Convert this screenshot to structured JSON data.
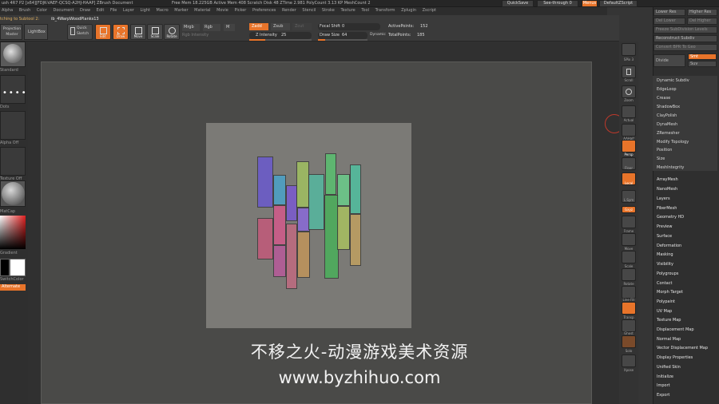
{
  "window": {
    "title_left": "ush 4R7 P2 [x64][FDJK-VAEF-QCSQ-A2HJ-HAAP]   ZBrush Document",
    "status": "Free Mem 18.225GB   Active Mem 408   Scratch Disk 48   ZTime 2.981   PolyCount 3.13 KP   MeshCount 2",
    "quicksave": "QuickSave",
    "seethrough": "See-through   0",
    "menus_btn": "Menus",
    "default_script": "DefaultZScript"
  },
  "menubar": [
    "Alpha",
    "Brush",
    "Color",
    "Document",
    "Draw",
    "Edit",
    "File",
    "Layer",
    "Light",
    "Macro",
    "Marker",
    "Material",
    "Movie",
    "Picker",
    "Preferences",
    "Render",
    "Stencil",
    "Stroke",
    "Texture",
    "Tool",
    "Transform",
    "Zplugin",
    "Zscript"
  ],
  "toolbar": {
    "switch_label": "tching to Subtool 2:",
    "subtool_name": "ib_4WarpWoodPlanks13",
    "projection_master": "Projection Master",
    "lightbox": "LightBox",
    "quick_sketch": "Quick Sketch",
    "tools": [
      "Edit",
      "Draw",
      "Move",
      "Scale",
      "Rotate"
    ],
    "mrgb": "Mrgb",
    "rgb": "Rgb",
    "m": "M",
    "rgb_intensity": "Rgb Intensity",
    "zadd": "Zadd",
    "zsub": "Zsub",
    "zcut": "Zcut",
    "z_intensity_label": "Z Intensity",
    "z_intensity_value": "25",
    "focal_shift_label": "Focal Shift",
    "focal_shift_value": "0",
    "draw_size_label": "Draw Size",
    "draw_size_value": "64",
    "dynamic": "Dynamic",
    "active_points_label": "ActivePoints:",
    "active_points_value": "152",
    "total_points_label": "TotalPoints:",
    "total_points_value": "185"
  },
  "left_shelf": {
    "labels": [
      "Standard",
      "Dots",
      "Alpha Off",
      "Texture Off",
      "MatCap",
      "Gradient",
      "SwitchColor",
      "Alternate"
    ]
  },
  "right_shelf": {
    "labels": [
      "SPix 3",
      "Scroll",
      "Zoom",
      "Actual",
      "AAHalf",
      "Persp",
      "Floor",
      "Local",
      "L.Sym",
      "Gxyz",
      "Frame",
      "Move",
      "Scale",
      "Rotate",
      "Line Fill",
      "Transp",
      "Ghost",
      "Solo",
      "Xpose"
    ]
  },
  "palette": {
    "top_buttons": [
      "Lower Res",
      "Higher Res",
      "Del Lower",
      "Del Higher",
      "Freeze SubDivision Levels",
      "Reconstruct Subdiv",
      "Convert BPR To Geo",
      "Smt",
      "Suv"
    ],
    "divide": "Divide",
    "subitems": [
      "Dynamic Subdiv",
      "EdgeLoop",
      "Crease",
      "ShadowBox",
      "ClayPolish",
      "DynaMesh",
      "ZRemesher",
      "Modify Topology",
      "Position",
      "Size",
      "MeshIntegrity"
    ],
    "items": [
      "ArrayMesh",
      "NanoMesh",
      "Layers",
      "FiberMesh",
      "Geometry HD",
      "Preview",
      "Surface",
      "Deformation",
      "Masking",
      "Visibility",
      "Polygroups",
      "Contact",
      "Morph Target",
      "Polypaint",
      "UV Map",
      "Texture Map",
      "Displacement Map",
      "Normal Map",
      "Vector Displacement Map",
      "Display Properties",
      "Unified Skin",
      "Initialize",
      "Import",
      "Export"
    ]
  },
  "planks": [
    {
      "color": "#6a5acd"
    },
    {
      "color": "#c25a7a"
    },
    {
      "color": "#4aa3c9"
    },
    {
      "color": "#7a5ad0"
    },
    {
      "color": "#d25a8a"
    },
    {
      "color": "#b85a9a"
    },
    {
      "color": "#a0c060"
    },
    {
      "color": "#8a6ad8"
    },
    {
      "color": "#c06a80"
    },
    {
      "color": "#55b8a0"
    },
    {
      "color": "#c0955a"
    },
    {
      "color": "#5ac070"
    },
    {
      "color": "#4ab05a"
    },
    {
      "color": "#6acd8a"
    },
    {
      "color": "#a8c060"
    },
    {
      "color": "#50c0a0"
    },
    {
      "color": "#c0a060"
    }
  ],
  "watermark": {
    "line1": "不移之火-动漫游戏美术资源",
    "line2": "www.byzhihuo.com"
  },
  "colors": {
    "accent": "#e8742a",
    "background": "#353535",
    "document": "#7b7a76"
  }
}
